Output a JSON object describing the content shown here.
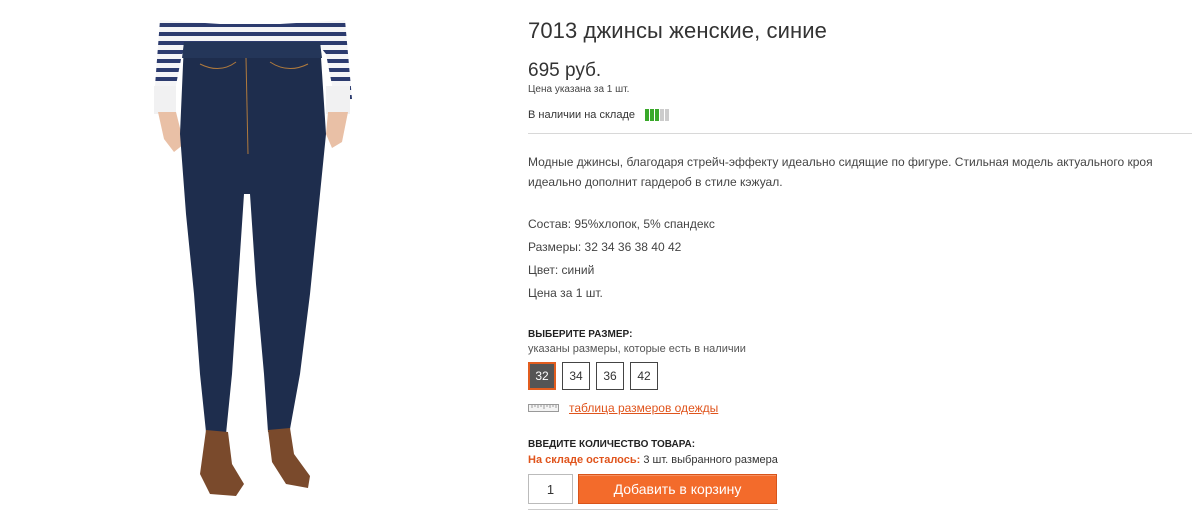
{
  "product": {
    "title": "7013 джинсы женские, синие",
    "price": "695 руб.",
    "price_note": "Цена указана за 1 шт.",
    "stock_label": "В наличии на складе",
    "stock_level": 0.6,
    "stock_colors": [
      "#39a92a",
      "#cccccc"
    ],
    "description_line1": "Модные джинсы, благодаря стрейч-эффекту идеально сидящие по фигуре. Стильная модель актуального кроя",
    "description_line2": "идеально дополнит гардероб в стиле кэжуал.",
    "specs": {
      "composition": "Состав: 95%хлопок, 5% спандекс",
      "sizes": "Размеры: 32 34 36 38 40 42",
      "color": "Цвет: синий",
      "price_per": "Цена за 1 шт."
    }
  },
  "size_select": {
    "title": "ВЫБЕРИТЕ РАЗМЕР:",
    "note": "указаны размеры, которые есть в наличии",
    "options": [
      "32",
      "34",
      "36",
      "42"
    ],
    "selected": "32",
    "table_link": "таблица размеров одежды"
  },
  "quantity": {
    "title": "ВВЕДИТЕ КОЛИЧЕСТВО ТОВАРА:",
    "left_label": "На складе осталось:",
    "left_value": "3 шт. выбранного размера",
    "value": "1"
  },
  "cart": {
    "button_label": "Добавить в корзину"
  },
  "colors": {
    "accent": "#e0541c",
    "button": "#f36b2b"
  },
  "icons": {
    "ruler": "ruler-icon"
  }
}
